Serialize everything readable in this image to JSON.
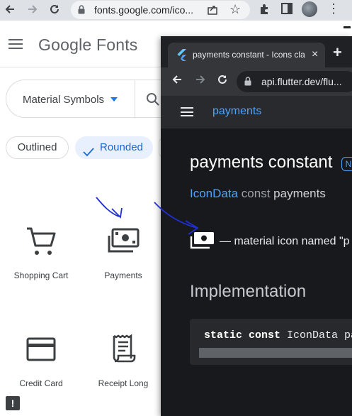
{
  "back_window": {
    "url": "fonts.google.com/ico...",
    "logo": "Google Fonts",
    "search": {
      "dropdown_label": "Material Symbols"
    },
    "style_chips": [
      {
        "label": "Outlined",
        "selected": false
      },
      {
        "label": "Rounded",
        "selected": true
      }
    ],
    "icons": [
      {
        "name": "Shopping Cart",
        "icon": "shopping-cart-icon"
      },
      {
        "name": "Payments",
        "icon": "payments-icon"
      },
      {
        "name": "Credit Card",
        "icon": "credit-card-icon"
      },
      {
        "name": "Receipt Long",
        "icon": "receipt-long-icon"
      }
    ],
    "feedback": "!"
  },
  "front_window": {
    "tab": {
      "title": "payments constant - Icons cla"
    },
    "url": "api.flutter.dev/flu...",
    "breadcrumb": "payments",
    "doc": {
      "title": "payments constant",
      "badge": "N",
      "signature": {
        "type": "IconData",
        "keyword": "const",
        "name": "payments"
      },
      "description": "— material icon named \"p",
      "implementation_heading": "Implementation",
      "code": {
        "keywords": "static const",
        "rest": " IconData pay"
      }
    }
  },
  "colors": {
    "link_blue": "#4fa3f7",
    "chip_selected_bg": "#e8f0fe",
    "chip_selected_text": "#1967d2",
    "annotation_ink": "#1f2fd1",
    "dark_page_bg": "#18191c"
  }
}
